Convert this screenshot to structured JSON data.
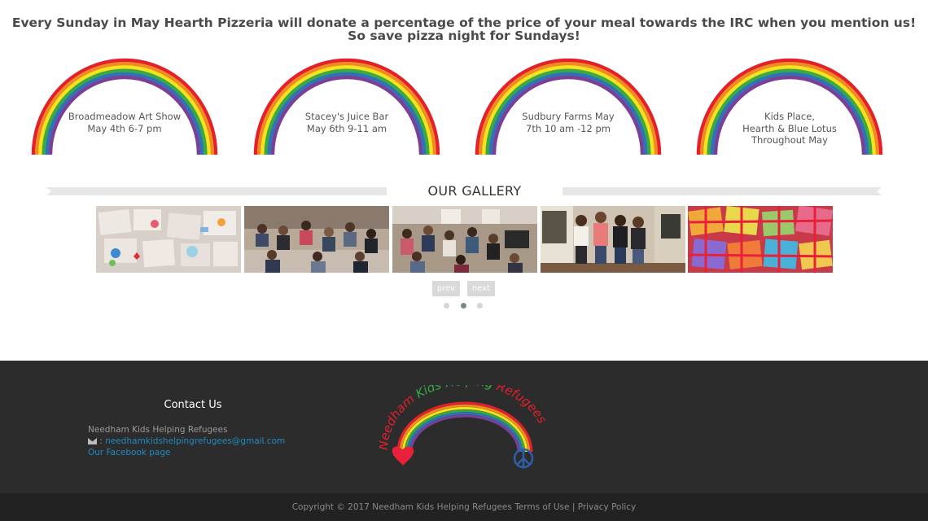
{
  "announcement": {
    "line1": "Every Sunday in May Hearth Pizzeria will donate a percentage of the price of your meal towards the IRC when you mention us!",
    "line2": "So save pizza night for Sundays!"
  },
  "events": [
    {
      "line1": "Broadmeadow Art Show",
      "line2": "May 4th 6-7 pm",
      "line3": ""
    },
    {
      "line1": "Stacey's Juice Bar",
      "line2": "May 6th 9-11 am",
      "line3": ""
    },
    {
      "line1": "Sudbury Farms May",
      "line2": "7th 10 am -12 pm",
      "line3": ""
    },
    {
      "line1": "Kids Place,",
      "line2": "Hearth & Blue Lotus",
      "line3": "Throughout May"
    }
  ],
  "gallery": {
    "title": "OUR GALLERY",
    "prev_label": "prev",
    "next_label": "next",
    "active_page": 2,
    "page_count": 3
  },
  "footer": {
    "contact_title": "Contact Us",
    "org_name": "Needham Kids Helping Refugees",
    "email": "needhamkidshelpingrefugees@gmail.com",
    "email_prefix": " : ",
    "facebook_label": "Our Facebook page",
    "logo_text": "Needham Kids Helping Refugees"
  },
  "copyright": {
    "text": "Copyright © 2017 Needham Kids Helping Refugees ",
    "terms_label": "Terms of Use",
    "separator": " | ",
    "privacy_label": "Privacy Policy"
  },
  "colors": {
    "footer_bg": "#2c2c2c",
    "link": "#1e8bc3",
    "rainbow": [
      "#e4202a",
      "#f08a24",
      "#f6e31c",
      "#3aa843",
      "#2f72b8",
      "#7b3f98"
    ]
  }
}
